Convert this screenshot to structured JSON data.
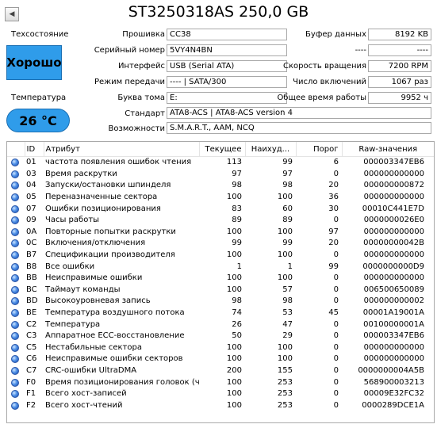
{
  "header": {
    "nav_glyph": "◀",
    "title": "ST3250318AS 250,0 GB"
  },
  "status": {
    "health_label": "Техсостояние",
    "health_value": "Хорошо",
    "temp_label": "Температура",
    "temp_value": "26 °C",
    "health_color": "#2f9cea"
  },
  "info": {
    "firmware_label": "Прошивка",
    "firmware": "CC38",
    "serial_label": "Серийный номер",
    "serial": "5VY4N4BN",
    "interface_label": "Интерфейс",
    "interface": "USB (Serial ATA)",
    "transfer_label": "Режим передачи",
    "transfer": "---- | SATA/300",
    "volume_label": "Буква тома",
    "volume": "E:",
    "standard_label": "Стандарт",
    "standard": "ATA8-ACS | ATA8-ACS version 4",
    "features_label": "Возможности",
    "features": "S.M.A.R.T., AAM, NCQ",
    "buffer_label": "Буфер данных",
    "buffer": "8192 KB",
    "right2_label": "----",
    "right2": "----",
    "rpm_label": "Скорость вращения",
    "rpm": "7200 RPM",
    "power_count_label": "Число включений",
    "power_count": "1067 раз",
    "hours_label": "Общее время работы",
    "hours": "9952 ч"
  },
  "table": {
    "columns": {
      "id": "ID",
      "attr": "Атрибут",
      "current": "Текущее",
      "worst": "Наихуд...",
      "threshold": "Порог",
      "raw": "Raw-значения"
    },
    "rows": [
      {
        "id": "01",
        "attr": "частота появления ошибок чтения",
        "cur": "113",
        "worst": "99",
        "thr": "6",
        "raw": "000003347EB6"
      },
      {
        "id": "03",
        "attr": "Время раскрутки",
        "cur": "97",
        "worst": "97",
        "thr": "0",
        "raw": "000000000000"
      },
      {
        "id": "04",
        "attr": "Запуски/остановки шпинделя",
        "cur": "98",
        "worst": "98",
        "thr": "20",
        "raw": "000000000872"
      },
      {
        "id": "05",
        "attr": "Переназначенные сектора",
        "cur": "100",
        "worst": "100",
        "thr": "36",
        "raw": "000000000000"
      },
      {
        "id": "07",
        "attr": "Ошибки позиционирования",
        "cur": "83",
        "worst": "60",
        "thr": "30",
        "raw": "00010C441E7D"
      },
      {
        "id": "09",
        "attr": "Часы работы",
        "cur": "89",
        "worst": "89",
        "thr": "0",
        "raw": "0000000026E0"
      },
      {
        "id": "0A",
        "attr": "Повторные попытки раскрутки",
        "cur": "100",
        "worst": "100",
        "thr": "97",
        "raw": "000000000000"
      },
      {
        "id": "0C",
        "attr": "Включения/отключения",
        "cur": "99",
        "worst": "99",
        "thr": "20",
        "raw": "00000000042B"
      },
      {
        "id": "B7",
        "attr": "Спецификации производителя",
        "cur": "100",
        "worst": "100",
        "thr": "0",
        "raw": "000000000000"
      },
      {
        "id": "B8",
        "attr": "Все ошибки",
        "cur": "1",
        "worst": "1",
        "thr": "99",
        "raw": "0000000000D9"
      },
      {
        "id": "BB",
        "attr": "Неисправимые ошибки",
        "cur": "100",
        "worst": "100",
        "thr": "0",
        "raw": "000000000000"
      },
      {
        "id": "BC",
        "attr": "Таймаут команды",
        "cur": "100",
        "worst": "57",
        "thr": "0",
        "raw": "006500650089"
      },
      {
        "id": "BD",
        "attr": "Высокоуровневая запись",
        "cur": "98",
        "worst": "98",
        "thr": "0",
        "raw": "000000000002"
      },
      {
        "id": "BE",
        "attr": "Температура воздушного потока",
        "cur": "74",
        "worst": "53",
        "thr": "45",
        "raw": "00001A19001A"
      },
      {
        "id": "C2",
        "attr": "Температура",
        "cur": "26",
        "worst": "47",
        "thr": "0",
        "raw": "00100000001A"
      },
      {
        "id": "C3",
        "attr": "Аппаратное ECC-восстановление",
        "cur": "50",
        "worst": "29",
        "thr": "0",
        "raw": "000003347EB6"
      },
      {
        "id": "C5",
        "attr": "Нестабильные сектора",
        "cur": "100",
        "worst": "100",
        "thr": "0",
        "raw": "000000000000"
      },
      {
        "id": "C6",
        "attr": "Неисправимые ошибки секторов",
        "cur": "100",
        "worst": "100",
        "thr": "0",
        "raw": "000000000000"
      },
      {
        "id": "C7",
        "attr": "CRC-ошибки UltraDMA",
        "cur": "200",
        "worst": "155",
        "thr": "0",
        "raw": "0000000004A5B"
      },
      {
        "id": "F0",
        "attr": "Время позиционирования головок (часы)",
        "cur": "100",
        "worst": "253",
        "thr": "0",
        "raw": "568900003213"
      },
      {
        "id": "F1",
        "attr": "Всего хост-записей",
        "cur": "100",
        "worst": "253",
        "thr": "0",
        "raw": "00009E32FC32"
      },
      {
        "id": "F2",
        "attr": "Всего хост-чтений",
        "cur": "100",
        "worst": "253",
        "thr": "0",
        "raw": "0000289DCE1A"
      }
    ]
  }
}
